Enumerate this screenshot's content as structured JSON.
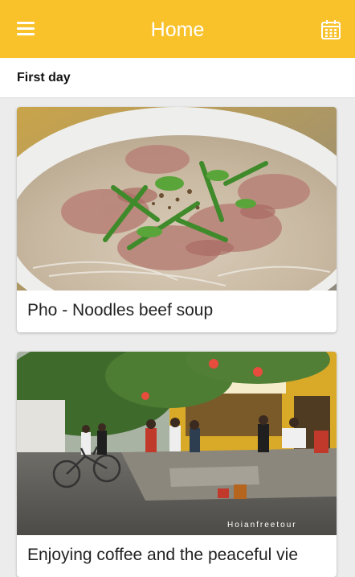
{
  "appbar": {
    "title": "Home",
    "menu_icon": "hamburger-menu-icon",
    "calendar_icon": "calendar-icon",
    "color": "#f9c22b"
  },
  "section": {
    "label": "First day"
  },
  "cards": [
    {
      "caption": "Pho - Noodles beef soup"
    },
    {
      "caption": "Enjoying coffee and the peaceful vie",
      "watermark": "Hoianfreetour"
    }
  ]
}
